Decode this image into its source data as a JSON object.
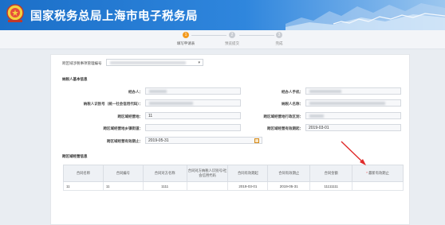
{
  "header": {
    "title": "国家税务总局上海市电子税务局"
  },
  "steps": [
    {
      "num": "1",
      "label": "填写申请表",
      "active": true
    },
    {
      "num": "2",
      "label": "预览提交",
      "active": false
    },
    {
      "num": "3",
      "label": "完成",
      "active": false
    }
  ],
  "registration": {
    "label": "跨区域涉税事项管理编号"
  },
  "sections": {
    "taxpayer": "纳税人基本信息",
    "contract": "跨区域经营信息"
  },
  "form": {
    "handler_label": "经办人：",
    "handler_phone_label": "经办人手机：",
    "taxpayer_id_label": "纳税人识别号（统一社会信用代码）：",
    "taxpayer_name_label": "纳税人名称：",
    "cross_location_label": "跨区域经营地：",
    "cross_location_value": "11",
    "cross_district_label": "跨区域经营地行政区划：",
    "cross_street_label": "跨区域经营地乡镇街道：",
    "valid_start_label": "跨区域经营有效期起：",
    "valid_start_value": "2019-03-01",
    "valid_end_label": "跨区域经营有效期止：",
    "valid_end_value": "2019-05-31"
  },
  "table": {
    "headers": [
      "合同名称",
      "合同编号",
      "合同对方名称",
      "合同对方纳税人识别号/社会信用代码",
      "合同有效期起",
      "合同有效期止",
      "合同金额",
      "最新有效期止"
    ],
    "rows": [
      [
        "11",
        "11",
        "1111",
        "",
        "2019-03-01",
        "2019-05-31",
        "11111111",
        ""
      ]
    ]
  }
}
